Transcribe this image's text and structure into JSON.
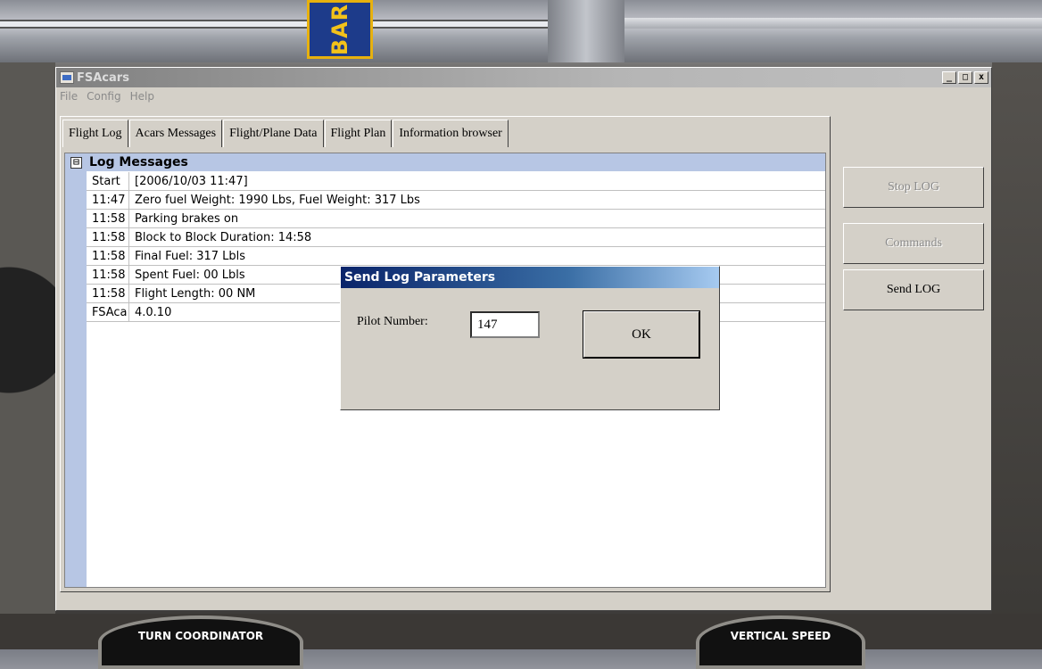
{
  "window": {
    "title": "FSAcars",
    "controls": {
      "minimize": "_",
      "maximize": "□",
      "close": "x"
    }
  },
  "menu": [
    "File",
    "Config",
    "Help"
  ],
  "tabs": [
    "Flight Log",
    "Acars Messages",
    "Flight/Plane Data",
    "Flight Plan",
    "Information browser"
  ],
  "log": {
    "header": "Log Messages",
    "expander": "⊟",
    "rows": [
      {
        "time": "Start",
        "message": "[2006/10/03 11:47]"
      },
      {
        "time": "11:47",
        "message": "Zero fuel Weight: 1990 Lbs, Fuel Weight: 317 Lbs"
      },
      {
        "time": "11:58",
        "message": "Parking brakes on"
      },
      {
        "time": "11:58",
        "message": "Block to Block Duration: 14:58"
      },
      {
        "time": "11:58",
        "message": "Final Fuel: 317 Lbls"
      },
      {
        "time": "11:58",
        "message": "Spent Fuel: 00 Lbls"
      },
      {
        "time": "11:58",
        "message": "Flight Length: 00 NM"
      },
      {
        "time": "FSAca",
        "message": "4.0.10"
      }
    ]
  },
  "side_buttons": {
    "stop_log": "Stop LOG",
    "commands": "Commands",
    "send_log": "Send LOG"
  },
  "dialog": {
    "title": "Send Log Parameters",
    "pilot_label": "Pilot Number:",
    "pilot_value": "147",
    "ok_label": "OK"
  },
  "background": {
    "sign_text": "BAR",
    "turn_coordinator": "TURN COORDINATOR",
    "vertical_speed": "VERTICAL SPEED"
  }
}
